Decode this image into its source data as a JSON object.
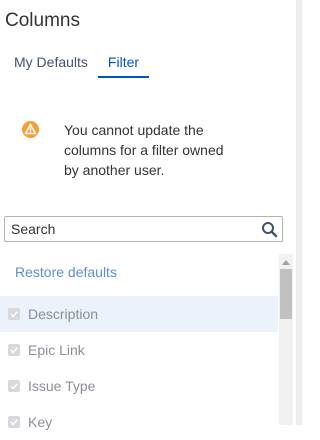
{
  "panel": {
    "title": "Columns"
  },
  "tabs": [
    {
      "label": "My Defaults",
      "active": false
    },
    {
      "label": "Filter",
      "active": true
    }
  ],
  "warning": {
    "icon": "warning-icon",
    "text": "You cannot update the columns for a filter owned by another user."
  },
  "search": {
    "placeholder": "Search",
    "value": ""
  },
  "restore_label": "Restore defaults",
  "columns": [
    {
      "label": "Description",
      "checked": true
    },
    {
      "label": "Epic Link",
      "checked": true
    },
    {
      "label": "Issue Type",
      "checked": true
    },
    {
      "label": "Key",
      "checked": true
    }
  ],
  "colors": {
    "accent": "#0052cc",
    "warning": "#f69e35",
    "link": "#5b8fd6"
  }
}
